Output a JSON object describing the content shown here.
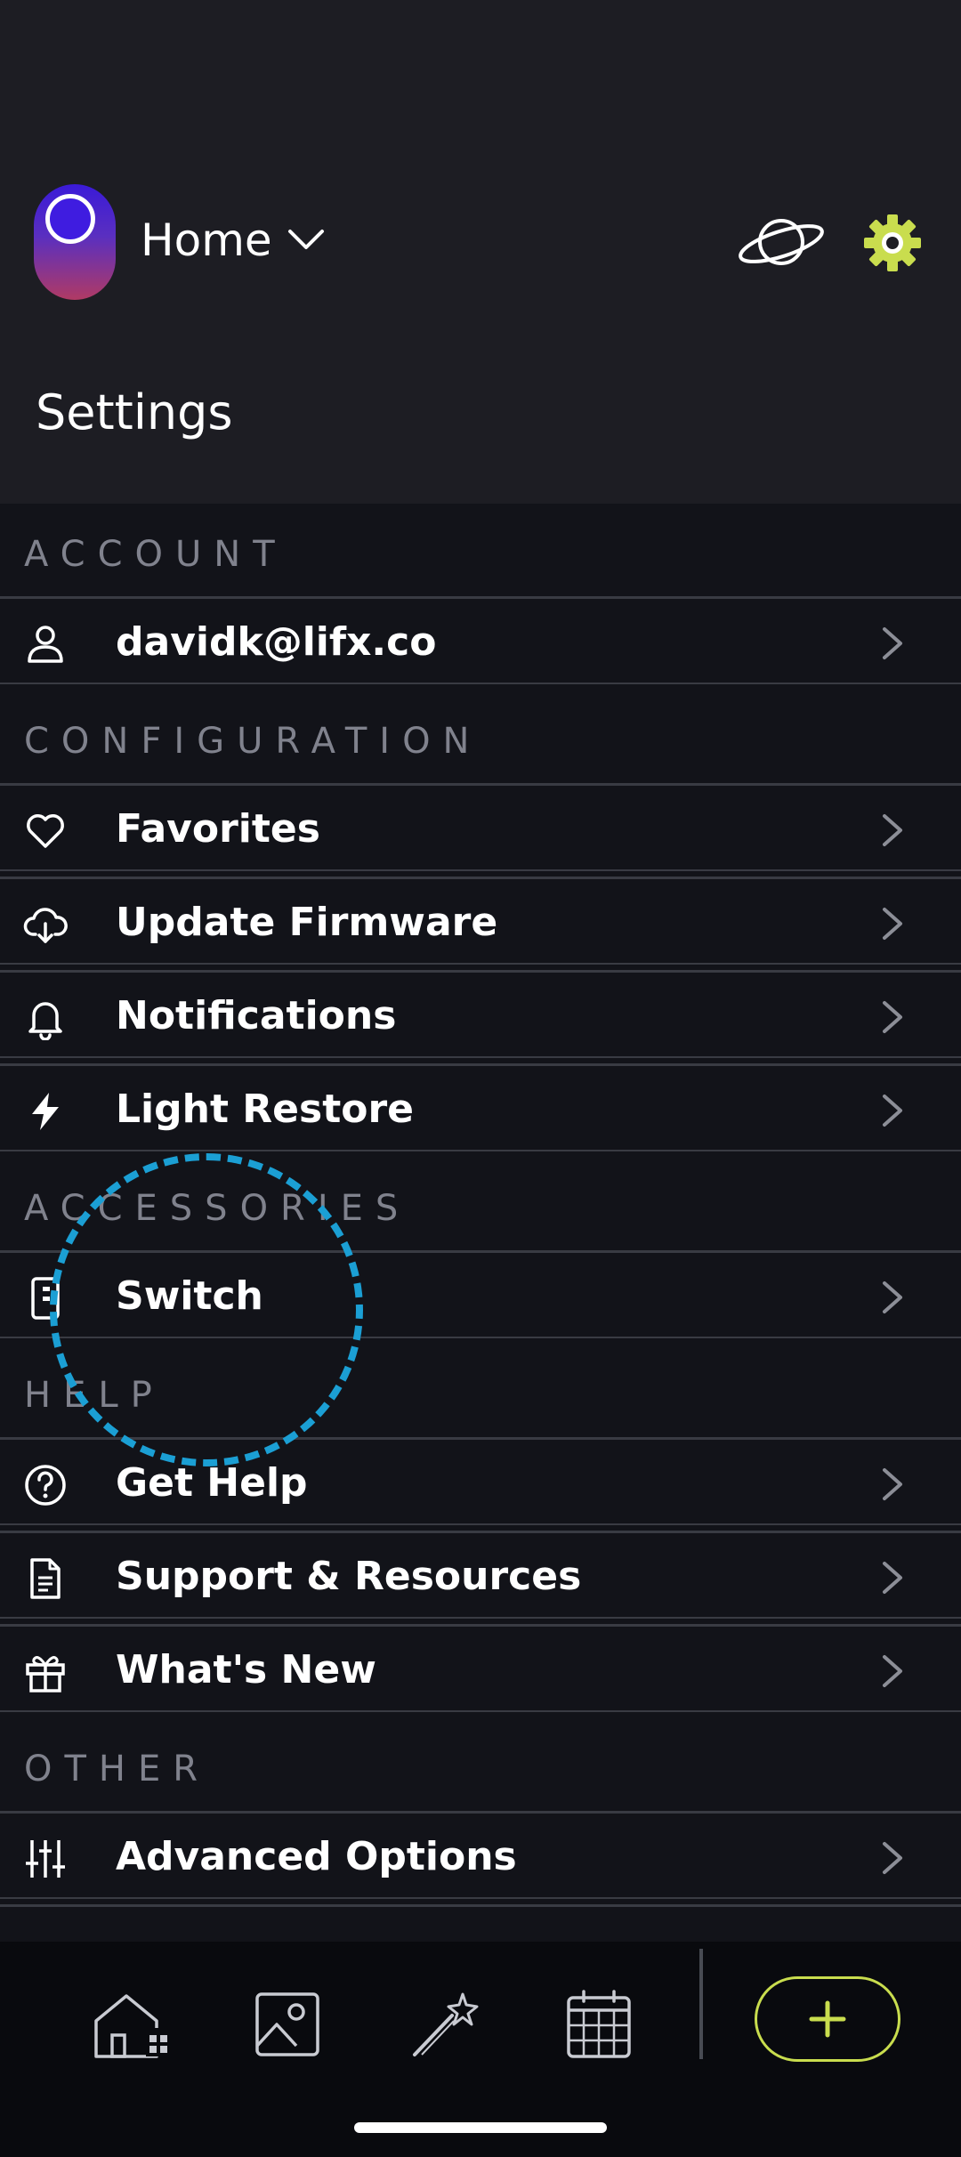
{
  "header": {
    "home_label": "Home",
    "page_title": "Settings",
    "icons": {
      "home_selector": "chevron-down-icon",
      "discover": "planet-icon",
      "settings": "gear-icon"
    },
    "accent_color": "#c9dd4e"
  },
  "sections": {
    "account": {
      "label": "ACCOUNT",
      "items": [
        {
          "label": "davidk@lifx.co",
          "icon": "user-icon"
        }
      ]
    },
    "configuration": {
      "label": "CONFIGURATION",
      "items": [
        {
          "label": "Favorites",
          "icon": "heart-icon"
        },
        {
          "label": "Update Firmware",
          "icon": "cloud-download-icon"
        },
        {
          "label": "Notifications",
          "icon": "bell-icon"
        },
        {
          "label": "Light Restore",
          "icon": "lightning-icon"
        }
      ]
    },
    "accessories": {
      "label": "ACCESSORIES",
      "items": [
        {
          "label": "Switch",
          "icon": "switch-icon"
        }
      ]
    },
    "help": {
      "label": "HELP",
      "items": [
        {
          "label": "Get Help",
          "icon": "question-icon"
        },
        {
          "label": "Support & Resources",
          "icon": "document-icon"
        },
        {
          "label": "What's New",
          "icon": "gift-icon"
        }
      ]
    },
    "other": {
      "label": "OTHER",
      "items": [
        {
          "label": "Advanced Options",
          "icon": "sliders-icon"
        }
      ]
    }
  },
  "tabbar": {
    "tabs": [
      {
        "name": "home",
        "icon": "home-icon"
      },
      {
        "name": "scenes",
        "icon": "image-icon"
      },
      {
        "name": "effects",
        "icon": "magic-wand-icon"
      },
      {
        "name": "schedules",
        "icon": "calendar-icon"
      }
    ],
    "add_button_icon": "plus-icon"
  }
}
